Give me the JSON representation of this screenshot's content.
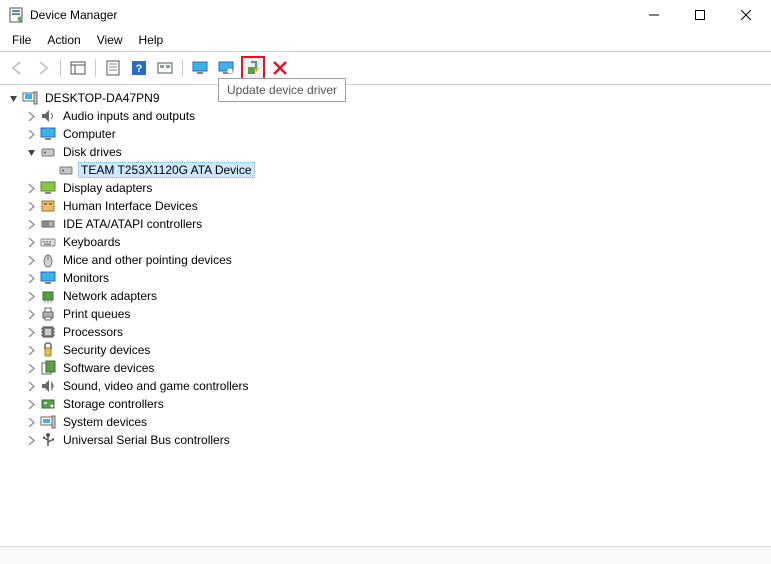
{
  "window": {
    "title": "Device Manager"
  },
  "menu": {
    "file": "File",
    "action": "Action",
    "view": "View",
    "help": "Help"
  },
  "tooltip": {
    "update_driver": "Update device driver"
  },
  "tree": {
    "root": "DESKTOP-DA47PN9",
    "items": [
      {
        "label": "Audio inputs and outputs",
        "icon": "audio"
      },
      {
        "label": "Computer",
        "icon": "computer"
      },
      {
        "label": "Disk drives",
        "icon": "disk",
        "expanded": true,
        "children": [
          {
            "label": "TEAM T253X1120G ATA Device",
            "icon": "disk",
            "selected": true
          }
        ]
      },
      {
        "label": "Display adapters",
        "icon": "display"
      },
      {
        "label": "Human Interface Devices",
        "icon": "hid"
      },
      {
        "label": "IDE ATA/ATAPI controllers",
        "icon": "ide"
      },
      {
        "label": "Keyboards",
        "icon": "keyboard"
      },
      {
        "label": "Mice and other pointing devices",
        "icon": "mouse"
      },
      {
        "label": "Monitors",
        "icon": "monitor"
      },
      {
        "label": "Network adapters",
        "icon": "network"
      },
      {
        "label": "Print queues",
        "icon": "printer"
      },
      {
        "label": "Processors",
        "icon": "cpu"
      },
      {
        "label": "Security devices",
        "icon": "security"
      },
      {
        "label": "Software devices",
        "icon": "software"
      },
      {
        "label": "Sound, video and game controllers",
        "icon": "sound"
      },
      {
        "label": "Storage controllers",
        "icon": "storage"
      },
      {
        "label": "System devices",
        "icon": "system"
      },
      {
        "label": "Universal Serial Bus controllers",
        "icon": "usb"
      }
    ]
  }
}
